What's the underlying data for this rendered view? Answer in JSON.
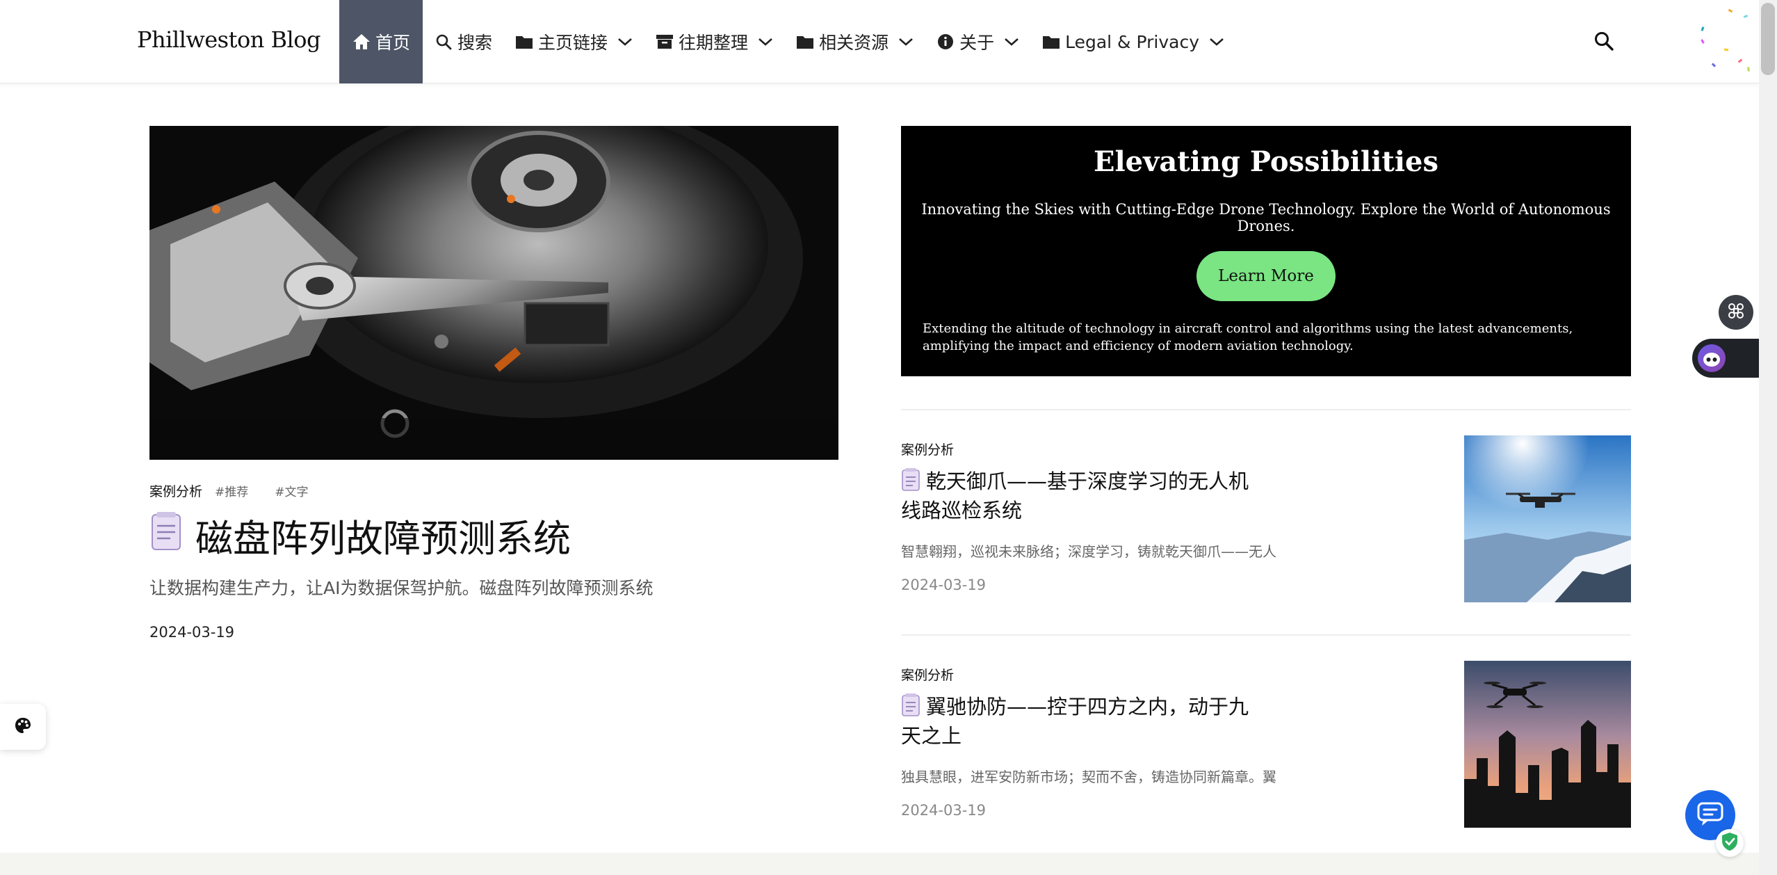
{
  "nav": {
    "brand": "Phillweston Blog",
    "items": [
      {
        "label": "首页",
        "icon": "home-icon",
        "active": true
      },
      {
        "label": "搜索",
        "icon": "search-icon"
      },
      {
        "label": "主页链接",
        "icon": "folder-icon",
        "dropdown": true
      },
      {
        "label": "往期整理",
        "icon": "archive-icon",
        "dropdown": true
      },
      {
        "label": "相关资源",
        "icon": "folder-icon",
        "dropdown": true
      },
      {
        "label": "关于",
        "icon": "info-icon",
        "dropdown": true
      },
      {
        "label": "Legal & Privacy",
        "icon": "folder-icon",
        "dropdown": true
      }
    ]
  },
  "hero": {
    "category": "案例分析",
    "tags": [
      "#推荐",
      "#文字"
    ],
    "title": "磁盘阵列故障预测系统",
    "description": "让数据构建生产力，让AI为数据保驾护航。磁盘阵列故障预测系统",
    "date": "2024-03-19"
  },
  "promo": {
    "title": "Elevating Possibilities",
    "subtitle": "Innovating the Skies with Cutting-Edge Drone Technology. Explore the World of Autonomous Drones.",
    "button": "Learn More",
    "footer": "Extending the altitude of technology in aircraft control and algorithms using the latest advancements, amplifying the impact and efficiency of modern aviation technology.",
    "button_color": "#7ae582"
  },
  "posts": [
    {
      "category": "案例分析",
      "title": "乾天御爪——基于深度学习的无人机线路巡检系统",
      "excerpt": "智慧翱翔，巡视未来脉络；深度学习，铸就乾天御爪——无人",
      "date": "2024-03-19"
    },
    {
      "category": "案例分析",
      "title": "翼驰协防——控于四方之内，动于九天之上",
      "excerpt": "独具慧眼，进军安防新市场；契而不舍，铸造协同新篇章。翼",
      "date": "2024-03-19"
    }
  ],
  "colors": {
    "nav_active": "#4d5566",
    "chat_button": "#1a66e8"
  }
}
